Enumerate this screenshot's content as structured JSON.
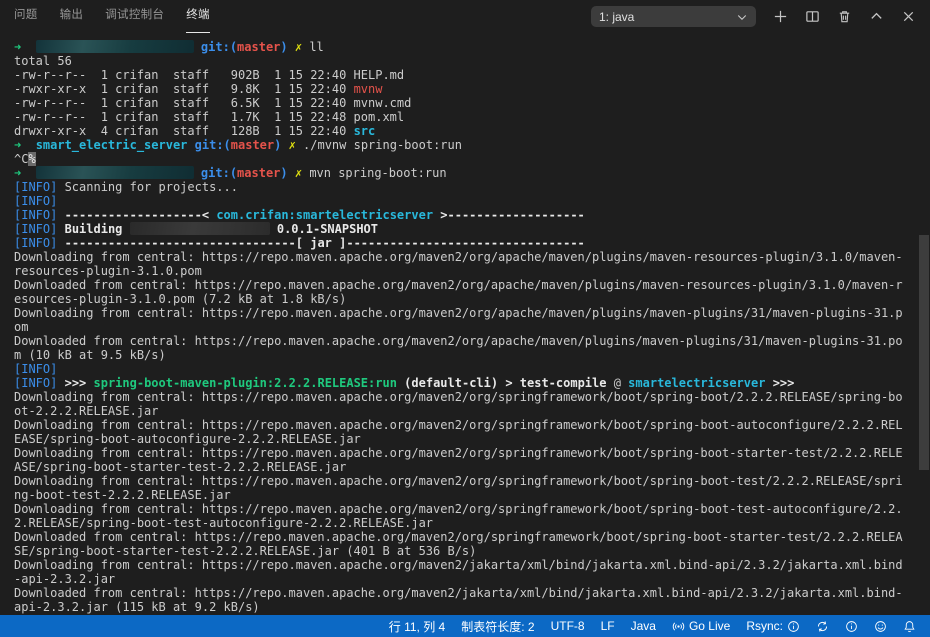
{
  "panel": {
    "tabs": [
      {
        "label": "问题",
        "active": false
      },
      {
        "label": "输出",
        "active": false
      },
      {
        "label": "调试控制台",
        "active": false
      },
      {
        "label": "终端",
        "active": true
      }
    ],
    "terminal_picker_value": "1: java",
    "actions": {
      "new_terminal": "new-terminal",
      "split_terminal": "split-terminal",
      "kill_terminal": "kill-terminal",
      "maximize_panel": "maximize-panel",
      "close_panel": "close-panel"
    }
  },
  "terminal": {
    "lines": [
      [
        {
          "t": "➜  ",
          "s": "gb"
        },
        {
          "redact": "teal",
          "w": 158
        },
        {
          "t": " ",
          "s": "p"
        },
        {
          "t": "git:(",
          "s": "bb"
        },
        {
          "t": "master",
          "s": "rb"
        },
        {
          "t": ") ",
          "s": "bb"
        },
        {
          "t": "✗ ",
          "s": "yb"
        },
        {
          "t": "ll",
          "s": "p"
        }
      ],
      [
        {
          "t": "total 56",
          "s": "p"
        }
      ],
      [
        {
          "t": "-rw-r--r--  1 crifan  staff   902B  1 15 22:40 HELP.md",
          "s": "p"
        }
      ],
      [
        {
          "t": "-rwxr-xr-x  1 crifan  staff   9.8K  1 15 22:40 ",
          "s": "p"
        },
        {
          "t": "mvnw",
          "s": "r"
        }
      ],
      [
        {
          "t": "-rw-r--r--  1 crifan  staff   6.5K  1 15 22:40 mvnw.cmd",
          "s": "p"
        }
      ],
      [
        {
          "t": "-rw-r--r--  1 crifan  staff   1.7K  1 15 22:48 pom.xml",
          "s": "p"
        }
      ],
      [
        {
          "t": "drwxr-xr-x  4 crifan  staff   128B  1 15 22:40 ",
          "s": "p"
        },
        {
          "t": "src",
          "s": "cb"
        }
      ],
      [
        {
          "t": "➜  ",
          "s": "gb"
        },
        {
          "t": "smart_electric_server",
          "s": "cb"
        },
        {
          "t": " ",
          "s": "p"
        },
        {
          "t": "git:(",
          "s": "bb"
        },
        {
          "t": "master",
          "s": "rb"
        },
        {
          "t": ") ",
          "s": "bb"
        },
        {
          "t": "✗ ",
          "s": "yb"
        },
        {
          "t": "./mvnw spring-boot:run",
          "s": "p"
        }
      ],
      [
        {
          "t": "^C",
          "s": "p"
        },
        {
          "t": "%",
          "s": "inv"
        }
      ],
      [
        {
          "t": "➜  ",
          "s": "gb"
        },
        {
          "redact": "teal",
          "w": 158
        },
        {
          "t": " ",
          "s": "p"
        },
        {
          "t": "git:(",
          "s": "bb"
        },
        {
          "t": "master",
          "s": "rb"
        },
        {
          "t": ") ",
          "s": "bb"
        },
        {
          "t": "✗ ",
          "s": "yb"
        },
        {
          "t": "mvn spring-boot:run",
          "s": "p"
        }
      ],
      [
        {
          "t": "[INFO]",
          "s": "b"
        },
        {
          "t": " Scanning for projects...",
          "s": "p"
        }
      ],
      [
        {
          "t": "[INFO]",
          "s": "b"
        }
      ],
      [
        {
          "t": "[INFO]",
          "s": "b"
        },
        {
          "t": " ",
          "s": "p"
        },
        {
          "t": "-------------------< ",
          "s": "bw"
        },
        {
          "t": "com.crifan:smartelectricserver",
          "s": "cb"
        },
        {
          "t": " >-------------------",
          "s": "bw"
        }
      ],
      [
        {
          "t": "[INFO]",
          "s": "b"
        },
        {
          "t": " ",
          "s": "p"
        },
        {
          "t": "Building ",
          "s": "bw"
        },
        {
          "redact": "gray",
          "w": 140
        },
        {
          "t": " ",
          "s": "p"
        },
        {
          "t": "0.0.1-SNAPSHOT",
          "s": "bw"
        }
      ],
      [
        {
          "t": "[INFO]",
          "s": "b"
        },
        {
          "t": " ",
          "s": "p"
        },
        {
          "t": "--------------------------------[ jar ]---------------------------------",
          "s": "bw"
        }
      ],
      [
        {
          "t": "Downloading from central: https://repo.maven.apache.org/maven2/org/apache/maven/plugins/maven-resources-plugin/3.1.0/maven-",
          "s": "p"
        }
      ],
      [
        {
          "t": "resources-plugin-3.1.0.pom",
          "s": "p"
        }
      ],
      [
        {
          "t": "Downloaded from central: https://repo.maven.apache.org/maven2/org/apache/maven/plugins/maven-resources-plugin/3.1.0/maven-r",
          "s": "p"
        }
      ],
      [
        {
          "t": "esources-plugin-3.1.0.pom (7.2 kB at 1.8 kB/s)",
          "s": "p"
        }
      ],
      [
        {
          "t": "Downloading from central: https://repo.maven.apache.org/maven2/org/apache/maven/plugins/maven-plugins/31/maven-plugins-31.p",
          "s": "p"
        }
      ],
      [
        {
          "t": "om",
          "s": "p"
        }
      ],
      [
        {
          "t": "Downloaded from central: https://repo.maven.apache.org/maven2/org/apache/maven/plugins/maven-plugins/31/maven-plugins-31.po",
          "s": "p"
        }
      ],
      [
        {
          "t": "m (10 kB at 9.5 kB/s)",
          "s": "p"
        }
      ],
      [
        {
          "t": "[INFO]",
          "s": "b"
        }
      ],
      [
        {
          "t": "[INFO]",
          "s": "b"
        },
        {
          "t": " ",
          "s": "p"
        },
        {
          "t": ">>> ",
          "s": "bw"
        },
        {
          "t": "spring-boot-maven-plugin:2.2.2.RELEASE:run",
          "s": "gb"
        },
        {
          "t": " ",
          "s": "p"
        },
        {
          "t": "(default-cli)",
          "s": "bw"
        },
        {
          "t": " > ",
          "s": "bw"
        },
        {
          "t": "test-compile",
          "s": "bw"
        },
        {
          "t": " @ ",
          "s": "p"
        },
        {
          "t": "smartelectricserver",
          "s": "cb"
        },
        {
          "t": " ",
          "s": "p"
        },
        {
          "t": ">>>",
          "s": "bw"
        }
      ],
      [
        {
          "t": "Downloading from central: https://repo.maven.apache.org/maven2/org/springframework/boot/spring-boot/2.2.2.RELEASE/spring-bo",
          "s": "p"
        }
      ],
      [
        {
          "t": "ot-2.2.2.RELEASE.jar",
          "s": "p"
        }
      ],
      [
        {
          "t": "Downloading from central: https://repo.maven.apache.org/maven2/org/springframework/boot/spring-boot-autoconfigure/2.2.2.REL",
          "s": "p"
        }
      ],
      [
        {
          "t": "EASE/spring-boot-autoconfigure-2.2.2.RELEASE.jar",
          "s": "p"
        }
      ],
      [
        {
          "t": "Downloading from central: https://repo.maven.apache.org/maven2/org/springframework/boot/spring-boot-starter-test/2.2.2.RELE",
          "s": "p"
        }
      ],
      [
        {
          "t": "ASE/spring-boot-starter-test-2.2.2.RELEASE.jar",
          "s": "p"
        }
      ],
      [
        {
          "t": "Downloading from central: https://repo.maven.apache.org/maven2/org/springframework/boot/spring-boot-test/2.2.2.RELEASE/spri",
          "s": "p"
        }
      ],
      [
        {
          "t": "ng-boot-test-2.2.2.RELEASE.jar",
          "s": "p"
        }
      ],
      [
        {
          "t": "Downloading from central: https://repo.maven.apache.org/maven2/org/springframework/boot/spring-boot-test-autoconfigure/2.2.",
          "s": "p"
        }
      ],
      [
        {
          "t": "2.RELEASE/spring-boot-test-autoconfigure-2.2.2.RELEASE.jar",
          "s": "p"
        }
      ],
      [
        {
          "t": "Downloaded from central: https://repo.maven.apache.org/maven2/org/springframework/boot/spring-boot-starter-test/2.2.2.RELEA",
          "s": "p"
        }
      ],
      [
        {
          "t": "SE/spring-boot-starter-test-2.2.2.RELEASE.jar (401 B at 536 B/s)",
          "s": "p"
        }
      ],
      [
        {
          "t": "Downloading from central: https://repo.maven.apache.org/maven2/jakarta/xml/bind/jakarta.xml.bind-api/2.3.2/jakarta.xml.bind",
          "s": "p"
        }
      ],
      [
        {
          "t": "-api-2.3.2.jar",
          "s": "p"
        }
      ],
      [
        {
          "t": "Downloaded from central: https://repo.maven.apache.org/maven2/jakarta/xml/bind/jakarta.xml.bind-api/2.3.2/jakarta.xml.bind-",
          "s": "p"
        }
      ],
      [
        {
          "t": "api-2.3.2.jar (115 kB at 9.2 kB/s)",
          "s": "p"
        }
      ]
    ]
  },
  "status_bar": {
    "cursor_position": "行 11, 列 4",
    "tab_size": "制表符长度: 2",
    "encoding": "UTF-8",
    "eol": "LF",
    "language": "Java",
    "go_live": "Go Live",
    "rsync": "Rsync:"
  },
  "colors": {
    "status_bar_bg": "#0c69c5",
    "terminal_bg": "#1e1e1e",
    "ansi_blue": "#3b8eea",
    "ansi_green": "#1fc97e",
    "ansi_red": "#e5534b",
    "ansi_cyan": "#29b8db",
    "ansi_yellow": "#e2e210"
  }
}
